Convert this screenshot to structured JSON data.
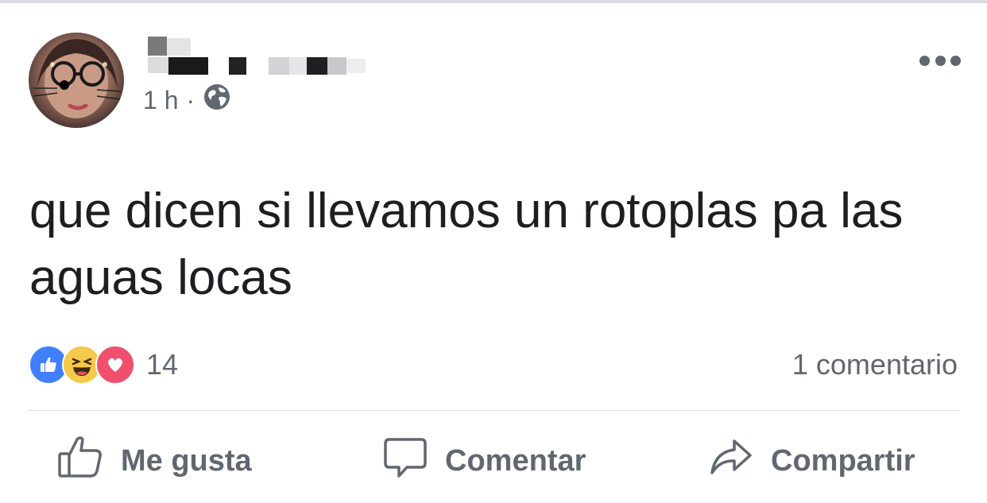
{
  "post": {
    "time": "1 h",
    "separator": "·",
    "audience_icon": "globe-icon",
    "text": "que dicen si llevamos un rotoplas pa las aguas locas"
  },
  "reactions": {
    "icons": [
      "like-reaction-icon",
      "haha-reaction-icon",
      "love-reaction-icon"
    ],
    "count": "14",
    "colors": {
      "like": "#4080ff",
      "haha": "#f7c94a",
      "love": "#f0506e"
    }
  },
  "comments_label": "1 comentario",
  "actions": {
    "like_label": "Me gusta",
    "comment_label": "Comentar",
    "share_label": "Compartir"
  }
}
